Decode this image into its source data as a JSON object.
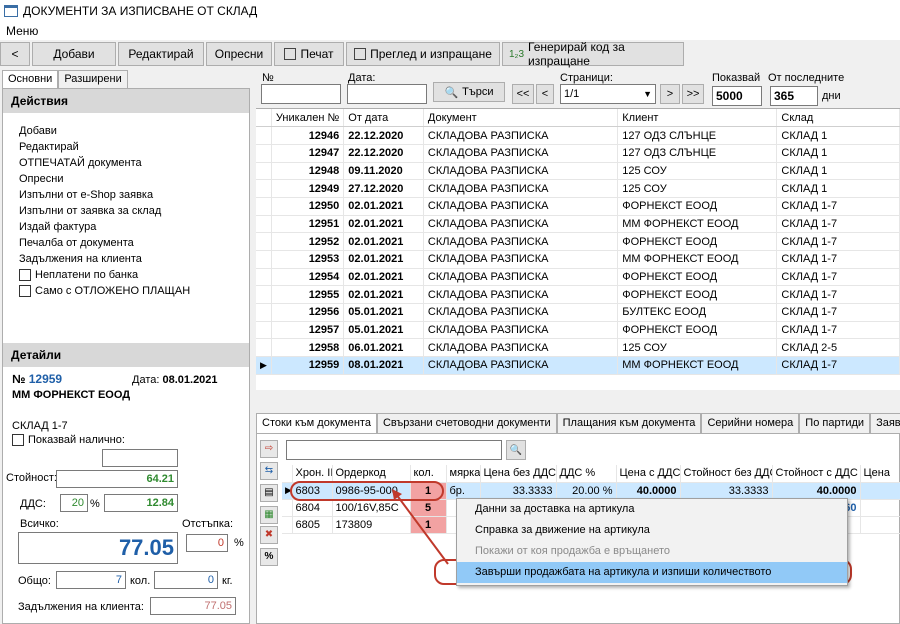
{
  "window": {
    "title": "ДОКУМЕНТИ ЗА ИЗПИСВАНЕ ОТ СКЛАД"
  },
  "menu": {
    "label": "Меню"
  },
  "toolbar": {
    "back": "<",
    "add": "Добави",
    "edit": "Редактирай",
    "refresh": "Опресни",
    "print": "Печат",
    "preview_send": "Преглед и изпращане",
    "generate_code": "Генерирай код за изпращане"
  },
  "left_tabs": {
    "basic": "Основни",
    "extended": "Разширени"
  },
  "actions": {
    "header": "Действия",
    "items": [
      "Добави",
      "Редактирай",
      "ОТПЕЧАТАЙ документа",
      "Опресни",
      "Изпълни от e-Shop заявка",
      "Изпълни от заявка за склад",
      "Издай фактура",
      "Печалба от документа",
      "Задължения на клиента"
    ],
    "unpaid_bank": "Неплатени по банка",
    "deferred_only": "Само с ОТЛОЖЕНО ПЛАЩАН"
  },
  "details": {
    "header": "Детайли",
    "no_label": "№",
    "no_value": "12959",
    "date_label": "Дата:",
    "date_value": "08.01.2021",
    "client": "ММ ФОРНЕКСТ ЕООД",
    "warehouse": "СКЛАД 1-7",
    "show_available": "Показвай налично:",
    "value_label": "Стойност:",
    "value": "64.21",
    "vat_label": "ДДС:",
    "vat_pct": "20",
    "pct_sign": "%",
    "vat_value": "12.84",
    "total_label": "Всичко:",
    "total": "77.05",
    "discount_label": "Отстъпка:",
    "discount": "0",
    "general_label": "Общо:",
    "qty": "7",
    "qty_unit": "кол.",
    "kg": "0",
    "kg_unit": "кг.",
    "debt_label": "Задължения на клиента:",
    "debt": "77.05"
  },
  "search": {
    "no_label": "№",
    "date_label": "Дата:",
    "search_btn": "Търси",
    "first": "<<",
    "prev": "<",
    "pages_label": "Страници:",
    "page": "1/1",
    "next": ">",
    "last": ">>",
    "show_label": "Показвай",
    "show_value": "5000",
    "from_last_label": "От последните",
    "days_value": "365",
    "days_unit": "дни"
  },
  "grid": {
    "columns": [
      "Уникален №",
      "От дата",
      "Документ",
      "Клиент",
      "Склад"
    ],
    "rows": [
      [
        "12946",
        "22.12.2020",
        "СКЛАДОВА РАЗПИСКА",
        "127 ОДЗ СЛЪНЦЕ",
        "СКЛАД 1"
      ],
      [
        "12947",
        "22.12.2020",
        "СКЛАДОВА РАЗПИСКА",
        "127 ОДЗ СЛЪНЦЕ",
        "СКЛАД 1"
      ],
      [
        "12948",
        "09.11.2020",
        "СКЛАДОВА РАЗПИСКА",
        "125 СОУ",
        "СКЛАД 1"
      ],
      [
        "12949",
        "27.12.2020",
        "СКЛАДОВА РАЗПИСКА",
        "125 СОУ",
        "СКЛАД 1"
      ],
      [
        "12950",
        "02.01.2021",
        "СКЛАДОВА РАЗПИСКА",
        "ФОРНЕКСТ ЕООД",
        "СКЛАД 1-7"
      ],
      [
        "12951",
        "02.01.2021",
        "СКЛАДОВА РАЗПИСКА",
        "ММ ФОРНЕКСТ ЕООД",
        "СКЛАД 1-7"
      ],
      [
        "12952",
        "02.01.2021",
        "СКЛАДОВА РАЗПИСКА",
        "ФОРНЕКСТ ЕООД",
        "СКЛАД 1-7"
      ],
      [
        "12953",
        "02.01.2021",
        "СКЛАДОВА РАЗПИСКА",
        "ММ ФОРНЕКСТ ЕООД",
        "СКЛАД 1-7"
      ],
      [
        "12954",
        "02.01.2021",
        "СКЛАДОВА РАЗПИСКА",
        "ФОРНЕКСТ ЕООД",
        "СКЛАД 1-7"
      ],
      [
        "12955",
        "02.01.2021",
        "СКЛАДОВА РАЗПИСКА",
        "ФОРНЕКСТ ЕООД",
        "СКЛАД 1-7"
      ],
      [
        "12956",
        "05.01.2021",
        "СКЛАДОВА РАЗПИСКА",
        "БУЛТЕКС ЕООД",
        "СКЛАД 1-7"
      ],
      [
        "12957",
        "05.01.2021",
        "СКЛАДОВА РАЗПИСКА",
        "ФОРНЕКСТ ЕООД",
        "СКЛАД 1-7"
      ],
      [
        "12958",
        "06.01.2021",
        "СКЛАДОВА РАЗПИСКА",
        "125 СОУ",
        "СКЛАД 2-5"
      ],
      [
        "12959",
        "08.01.2021",
        "СКЛАДОВА РАЗПИСКА",
        "ММ ФОРНЕКСТ ЕООД",
        "СКЛАД 1-7"
      ]
    ]
  },
  "bottom_tabs": [
    "Стоки към документа",
    "Свързани счетоводни документи",
    "Плащания към документа",
    "Серийни номера",
    "По партиди",
    "Заявки"
  ],
  "items_grid": {
    "columns": [
      "Хрон. II",
      "Ордеркод",
      "кол.",
      "мярка",
      "Цена без ДДС",
      "ДДС %",
      "Цена с ДДС",
      "Стойност без ДДС",
      "Стойност с ДДС",
      "Цена"
    ],
    "rows": [
      [
        "6803",
        "0986-95-000",
        "1",
        "бр.",
        "33.3333",
        "20.00 %",
        "40.0000",
        "33.3333",
        "40.0000",
        ""
      ],
      [
        "6804",
        "100/16V,85C",
        "5",
        "",
        "",
        "",
        "",
        "",
        "560",
        ""
      ],
      [
        "6805",
        "173809",
        "1",
        "",
        "",
        "",
        "",
        "",
        "",
        ""
      ]
    ]
  },
  "context_menu": {
    "items": [
      "Данни за доставка на артикула",
      "Справка за движение на артикула",
      "Покажи от коя продажба е връщането",
      "Завърши продажбата на артикула и изпиши количеството"
    ]
  },
  "side_buttons": {
    "percent": "%"
  }
}
